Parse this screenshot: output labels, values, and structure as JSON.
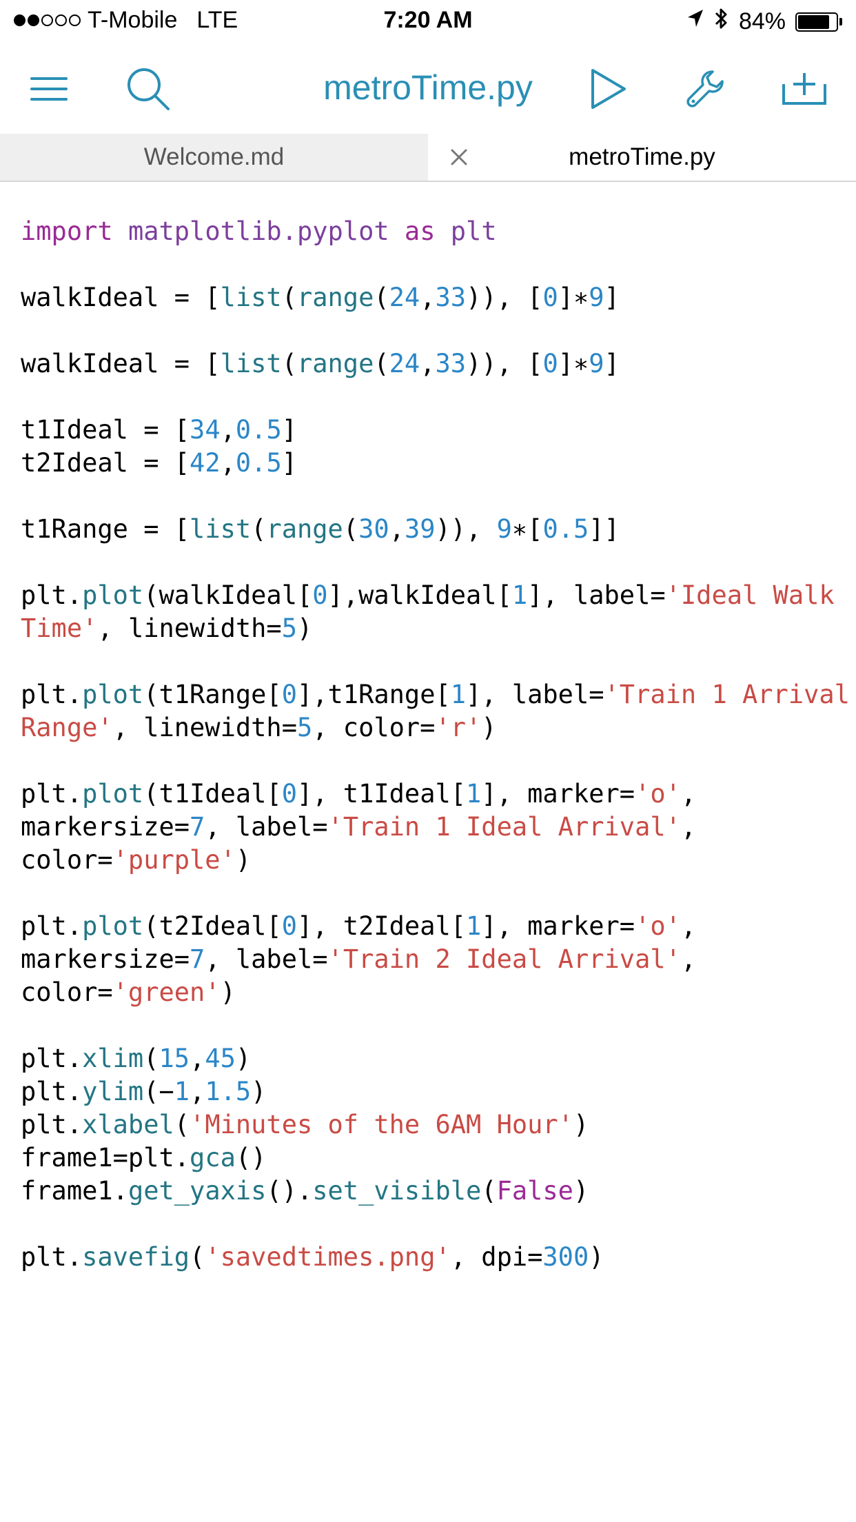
{
  "status_bar": {
    "carrier": "T-Mobile",
    "network": "LTE",
    "time": "7:20 AM",
    "battery_percent": "84%",
    "battery_level": 0.84,
    "signal_bars_filled": 2,
    "signal_bars_total": 5
  },
  "toolbar": {
    "title": "metroTime.py",
    "icons": [
      "menu-icon",
      "search-icon",
      "play-icon",
      "wrench-icon",
      "add-file-icon"
    ],
    "accent_color": "#2a8fb5"
  },
  "tabs": [
    {
      "label": "Welcome.md",
      "active": false
    },
    {
      "label": "metroTime.py",
      "active": true
    }
  ],
  "code_lines": [
    [
      [
        "kw",
        "import"
      ],
      [
        "plain",
        " "
      ],
      [
        "mod",
        "matplotlib.pyplot"
      ],
      [
        "plain",
        " "
      ],
      [
        "kw",
        "as"
      ],
      [
        "plain",
        " "
      ],
      [
        "mod",
        "plt"
      ]
    ],
    [],
    [
      [
        "plain",
        "walkIdeal = ["
      ],
      [
        "fn",
        "list"
      ],
      [
        "plain",
        "("
      ],
      [
        "fn",
        "range"
      ],
      [
        "plain",
        "("
      ],
      [
        "num",
        "24"
      ],
      [
        "plain",
        ","
      ],
      [
        "num",
        "33"
      ],
      [
        "plain",
        ")), ["
      ],
      [
        "num",
        "0"
      ],
      [
        "plain",
        "]∗"
      ],
      [
        "num",
        "9"
      ],
      [
        "plain",
        "]"
      ]
    ],
    [],
    [
      [
        "plain",
        "walkIdeal = ["
      ],
      [
        "fn",
        "list"
      ],
      [
        "plain",
        "("
      ],
      [
        "fn",
        "range"
      ],
      [
        "plain",
        "("
      ],
      [
        "num",
        "24"
      ],
      [
        "plain",
        ","
      ],
      [
        "num",
        "33"
      ],
      [
        "plain",
        ")), ["
      ],
      [
        "num",
        "0"
      ],
      [
        "plain",
        "]∗"
      ],
      [
        "num",
        "9"
      ],
      [
        "plain",
        "]"
      ]
    ],
    [],
    [
      [
        "plain",
        "t1Ideal = ["
      ],
      [
        "num",
        "34"
      ],
      [
        "plain",
        ","
      ],
      [
        "num",
        "0.5"
      ],
      [
        "plain",
        "]"
      ]
    ],
    [
      [
        "plain",
        "t2Ideal = ["
      ],
      [
        "num",
        "42"
      ],
      [
        "plain",
        ","
      ],
      [
        "num",
        "0.5"
      ],
      [
        "plain",
        "]"
      ]
    ],
    [],
    [
      [
        "plain",
        "t1Range = ["
      ],
      [
        "fn",
        "list"
      ],
      [
        "plain",
        "("
      ],
      [
        "fn",
        "range"
      ],
      [
        "plain",
        "("
      ],
      [
        "num",
        "30"
      ],
      [
        "plain",
        ","
      ],
      [
        "num",
        "39"
      ],
      [
        "plain",
        ")), "
      ],
      [
        "num",
        "9"
      ],
      [
        "plain",
        "∗["
      ],
      [
        "num",
        "0.5"
      ],
      [
        "plain",
        "]]"
      ]
    ],
    [],
    [
      [
        "plain",
        "plt."
      ],
      [
        "fn",
        "plot"
      ],
      [
        "plain",
        "(walkIdeal["
      ],
      [
        "num",
        "0"
      ],
      [
        "plain",
        "],walkIdeal["
      ],
      [
        "num",
        "1"
      ],
      [
        "plain",
        "], label="
      ],
      [
        "str",
        "'Ideal Walk"
      ]
    ],
    [
      [
        "str",
        "Time'"
      ],
      [
        "plain",
        ", linewidth="
      ],
      [
        "num",
        "5"
      ],
      [
        "plain",
        ")"
      ]
    ],
    [],
    [
      [
        "plain",
        "plt."
      ],
      [
        "fn",
        "plot"
      ],
      [
        "plain",
        "(t1Range["
      ],
      [
        "num",
        "0"
      ],
      [
        "plain",
        "],t1Range["
      ],
      [
        "num",
        "1"
      ],
      [
        "plain",
        "], label="
      ],
      [
        "str",
        "'Train 1 Arrival"
      ]
    ],
    [
      [
        "str",
        "Range'"
      ],
      [
        "plain",
        ", linewidth="
      ],
      [
        "num",
        "5"
      ],
      [
        "plain",
        ", color="
      ],
      [
        "str",
        "'r'"
      ],
      [
        "plain",
        ")"
      ]
    ],
    [],
    [
      [
        "plain",
        "plt."
      ],
      [
        "fn",
        "plot"
      ],
      [
        "plain",
        "(t1Ideal["
      ],
      [
        "num",
        "0"
      ],
      [
        "plain",
        "], t1Ideal["
      ],
      [
        "num",
        "1"
      ],
      [
        "plain",
        "], marker="
      ],
      [
        "str",
        "'o'"
      ],
      [
        "plain",
        ","
      ]
    ],
    [
      [
        "plain",
        "markersize="
      ],
      [
        "num",
        "7"
      ],
      [
        "plain",
        ", label="
      ],
      [
        "str",
        "'Train 1 Ideal Arrival'"
      ],
      [
        "plain",
        ","
      ]
    ],
    [
      [
        "plain",
        "color="
      ],
      [
        "str",
        "'purple'"
      ],
      [
        "plain",
        ")"
      ]
    ],
    [],
    [
      [
        "plain",
        "plt."
      ],
      [
        "fn",
        "plot"
      ],
      [
        "plain",
        "(t2Ideal["
      ],
      [
        "num",
        "0"
      ],
      [
        "plain",
        "], t2Ideal["
      ],
      [
        "num",
        "1"
      ],
      [
        "plain",
        "], marker="
      ],
      [
        "str",
        "'o'"
      ],
      [
        "plain",
        ","
      ]
    ],
    [
      [
        "plain",
        "markersize="
      ],
      [
        "num",
        "7"
      ],
      [
        "plain",
        ", label="
      ],
      [
        "str",
        "'Train 2 Ideal Arrival'"
      ],
      [
        "plain",
        ","
      ]
    ],
    [
      [
        "plain",
        "color="
      ],
      [
        "str",
        "'green'"
      ],
      [
        "plain",
        ")"
      ]
    ],
    [],
    [
      [
        "plain",
        "plt."
      ],
      [
        "fn",
        "xlim"
      ],
      [
        "plain",
        "("
      ],
      [
        "num",
        "15"
      ],
      [
        "plain",
        ","
      ],
      [
        "num",
        "45"
      ],
      [
        "plain",
        ")"
      ]
    ],
    [
      [
        "plain",
        "plt."
      ],
      [
        "fn",
        "ylim"
      ],
      [
        "plain",
        "(−"
      ],
      [
        "num",
        "1"
      ],
      [
        "plain",
        ","
      ],
      [
        "num",
        "1.5"
      ],
      [
        "plain",
        ")"
      ]
    ],
    [
      [
        "plain",
        "plt."
      ],
      [
        "fn",
        "xlabel"
      ],
      [
        "plain",
        "("
      ],
      [
        "str",
        "'Minutes of the 6AM Hour'"
      ],
      [
        "plain",
        ")"
      ]
    ],
    [
      [
        "plain",
        "frame1=plt."
      ],
      [
        "fn",
        "gca"
      ],
      [
        "plain",
        "()"
      ]
    ],
    [
      [
        "plain",
        "frame1."
      ],
      [
        "fn",
        "get_yaxis"
      ],
      [
        "plain",
        "()."
      ],
      [
        "fn",
        "set_visible"
      ],
      [
        "plain",
        "("
      ],
      [
        "bool",
        "False"
      ],
      [
        "plain",
        ")"
      ]
    ],
    [],
    [
      [
        "plain",
        "plt."
      ],
      [
        "fn",
        "savefig"
      ],
      [
        "plain",
        "("
      ],
      [
        "str",
        "'savedtimes.png'"
      ],
      [
        "plain",
        ", dpi="
      ],
      [
        "num",
        "300"
      ],
      [
        "plain",
        ")"
      ]
    ]
  ]
}
